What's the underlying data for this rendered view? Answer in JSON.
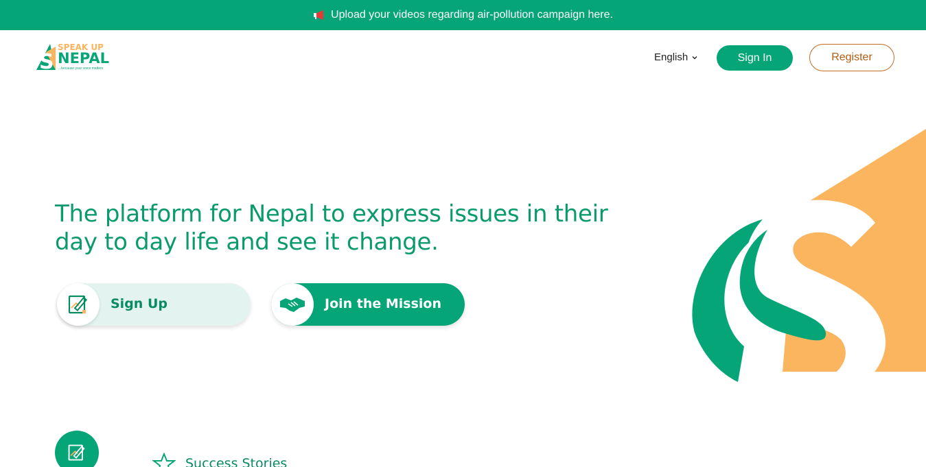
{
  "announcement": {
    "icon": "megaphone-icon",
    "text": "Upload your videos regarding air-pollution campaign here."
  },
  "logo": {
    "line1": "SPEAK UP",
    "line2": "NEPAL",
    "tagline": "...because your voice matters"
  },
  "header": {
    "language": "English",
    "signin_label": "Sign In",
    "register_label": "Register"
  },
  "hero": {
    "title": "The platform for Nepal to express issues in their day to day life and see it change.",
    "cta_signup": "Sign Up",
    "cta_join": "Join the Mission"
  },
  "sections": {
    "success_label": "Success Stories"
  },
  "colors": {
    "brand_green": "#05a577",
    "brand_orange": "#fbb55f",
    "register_border": "#c56920"
  }
}
